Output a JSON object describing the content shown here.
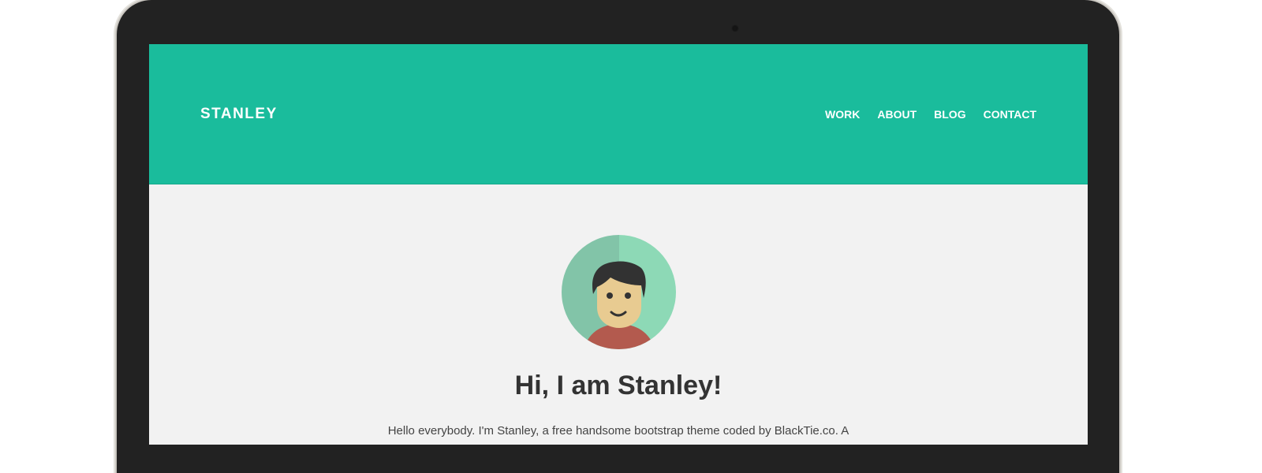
{
  "header": {
    "brand": "STANLEY",
    "nav": [
      "WORK",
      "ABOUT",
      "BLOG",
      "CONTACT"
    ]
  },
  "hero": {
    "avatar_icon": "avatar-illustration",
    "title": "Hi, I am Stanley!",
    "intro_text": "Hello everybody. I'm Stanley, a free handsome bootstrap theme coded by BlackTie.co. A"
  },
  "colors": {
    "accent": "#1abc9c",
    "background": "#f2f2f2",
    "device_frame": "#222222"
  }
}
